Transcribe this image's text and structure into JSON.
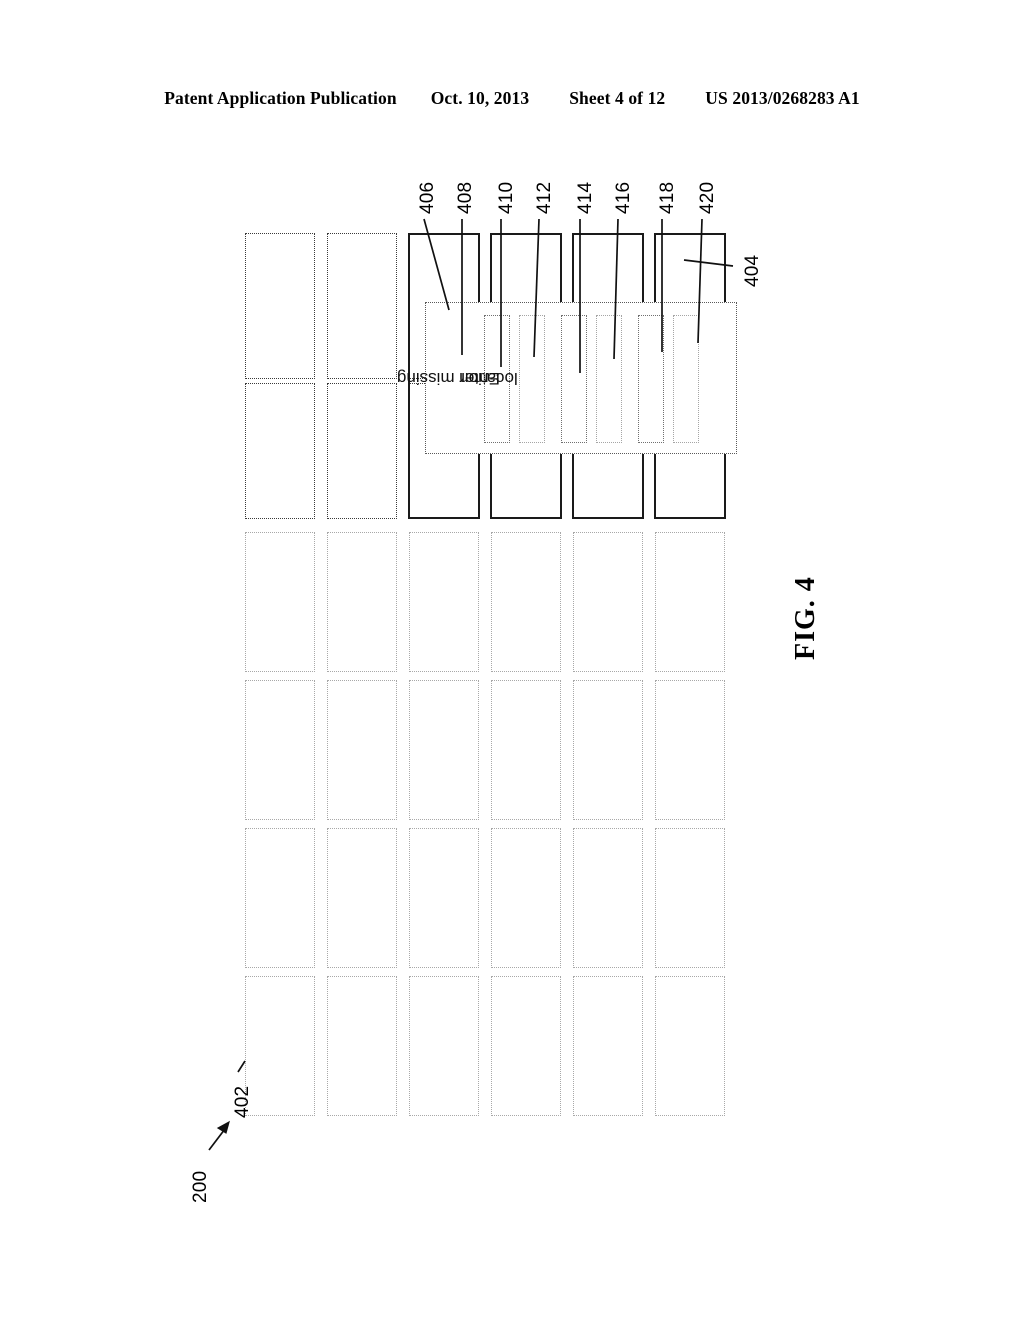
{
  "header": {
    "left": "Patent Application Publication",
    "date": "Oct. 10, 2013",
    "sheet": "Sheet 4 of 12",
    "patent_number": "US 2013/0268283 A1"
  },
  "figure": {
    "caption": "FIG. 4",
    "dialog": {
      "label": "Enter missing\nlocation",
      "label_line1": "Enter missing",
      "label_line2": "location"
    },
    "reference_numerals": [
      {
        "id": "200",
        "label": "200",
        "kind": "assembly-arrow"
      },
      {
        "id": "402",
        "label": "402",
        "kind": "leader"
      },
      {
        "id": "404",
        "label": "404",
        "kind": "leader"
      },
      {
        "id": "406",
        "label": "406",
        "kind": "leader"
      },
      {
        "id": "408",
        "label": "408",
        "kind": "leader"
      },
      {
        "id": "410",
        "label": "410",
        "kind": "leader"
      },
      {
        "id": "412",
        "label": "412",
        "kind": "leader"
      },
      {
        "id": "414",
        "label": "414",
        "kind": "leader"
      },
      {
        "id": "416",
        "label": "416",
        "kind": "leader"
      },
      {
        "id": "418",
        "label": "418",
        "kind": "leader"
      },
      {
        "id": "420",
        "label": "420",
        "kind": "leader"
      }
    ],
    "grid": {
      "columns": 6,
      "rows": 6
    },
    "colors": {
      "line": "#1a1a1a",
      "dotted": "#6f6f6f",
      "faint": "#a8a8a8",
      "background": "#ffffff"
    }
  }
}
